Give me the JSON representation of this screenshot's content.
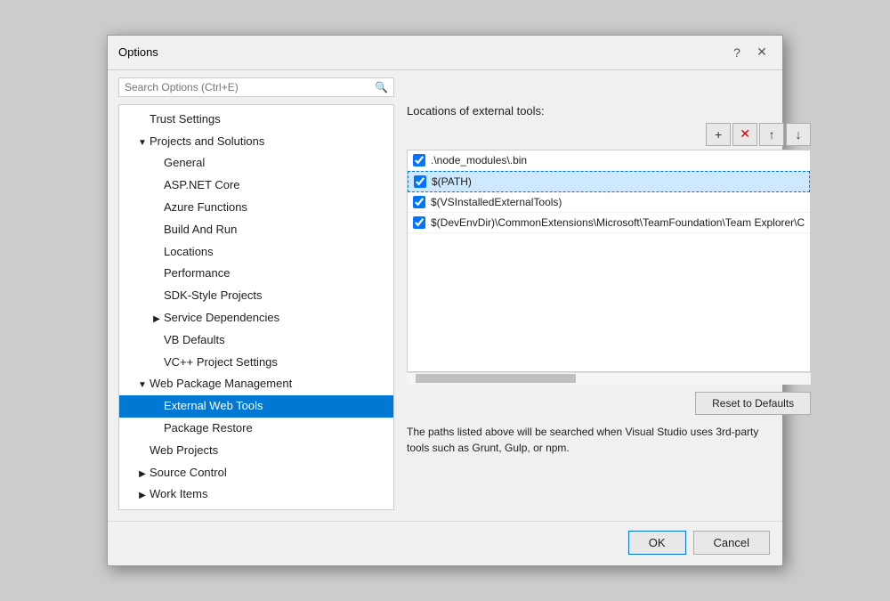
{
  "dialog": {
    "title": "Options",
    "help_btn": "?",
    "close_btn": "✕"
  },
  "search": {
    "placeholder": "Search Options (Ctrl+E)"
  },
  "sidebar": {
    "items": [
      {
        "id": "trust-settings",
        "label": "Trust Settings",
        "indent": 1,
        "toggle": "",
        "selected": false
      },
      {
        "id": "projects-and-solutions",
        "label": "Projects and Solutions",
        "indent": 1,
        "toggle": "▼",
        "selected": false
      },
      {
        "id": "general",
        "label": "General",
        "indent": 2,
        "toggle": "",
        "selected": false
      },
      {
        "id": "aspnet-core",
        "label": "ASP.NET Core",
        "indent": 2,
        "toggle": "",
        "selected": false
      },
      {
        "id": "azure-functions",
        "label": "Azure Functions",
        "indent": 2,
        "toggle": "",
        "selected": false
      },
      {
        "id": "build-and-run",
        "label": "Build And Run",
        "indent": 2,
        "toggle": "",
        "selected": false
      },
      {
        "id": "locations",
        "label": "Locations",
        "indent": 2,
        "toggle": "",
        "selected": false
      },
      {
        "id": "performance",
        "label": "Performance",
        "indent": 2,
        "toggle": "",
        "selected": false
      },
      {
        "id": "sdk-style-projects",
        "label": "SDK-Style Projects",
        "indent": 2,
        "toggle": "",
        "selected": false
      },
      {
        "id": "service-dependencies",
        "label": "Service Dependencies",
        "indent": 2,
        "toggle": "▶",
        "selected": false
      },
      {
        "id": "vb-defaults",
        "label": "VB Defaults",
        "indent": 2,
        "toggle": "",
        "selected": false
      },
      {
        "id": "vcpp-project-settings",
        "label": "VC++ Project Settings",
        "indent": 2,
        "toggle": "",
        "selected": false
      },
      {
        "id": "web-package-management",
        "label": "Web Package Management",
        "indent": 1,
        "toggle": "▼",
        "selected": false
      },
      {
        "id": "external-web-tools",
        "label": "External Web Tools",
        "indent": 2,
        "toggle": "",
        "selected": true
      },
      {
        "id": "package-restore",
        "label": "Package Restore",
        "indent": 2,
        "toggle": "",
        "selected": false
      },
      {
        "id": "web-projects",
        "label": "Web Projects",
        "indent": 1,
        "toggle": "",
        "selected": false
      },
      {
        "id": "source-control",
        "label": "Source Control",
        "indent": 1,
        "toggle": "▶",
        "selected": false
      },
      {
        "id": "work-items",
        "label": "Work Items",
        "indent": 1,
        "toggle": "▶",
        "selected": false
      }
    ]
  },
  "panel": {
    "header": "Locations of external tools:",
    "toolbar": {
      "add_label": "+",
      "remove_label": "✕",
      "up_label": "↑",
      "down_label": "↓"
    },
    "list_items": [
      {
        "id": "node-modules",
        "checked": true,
        "text": ".\\node_modules\\.bin",
        "selected_highlight": false,
        "selected": false
      },
      {
        "id": "path",
        "checked": true,
        "text": "$(PATH)",
        "selected_highlight": true,
        "selected": false
      },
      {
        "id": "vs-installed",
        "checked": true,
        "text": "$(VSInstalledExternalTools)",
        "selected_highlight": false,
        "selected": false
      },
      {
        "id": "devenvdir",
        "checked": true,
        "text": "$(DevEnvDir)\\CommonExtensions\\Microsoft\\TeamFoundation\\Team Explorer\\C",
        "selected_highlight": false,
        "selected": false
      }
    ],
    "reset_btn_label": "Reset to Defaults",
    "description": "The paths listed above will be searched when Visual Studio uses 3rd-party tools such as Grunt, Gulp, or npm."
  },
  "footer": {
    "ok_label": "OK",
    "cancel_label": "Cancel"
  }
}
